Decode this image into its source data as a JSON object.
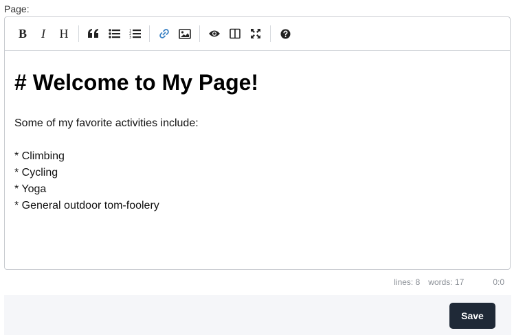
{
  "field_label": "Page:",
  "toolbar": {
    "groups": [
      [
        {
          "name": "bold-icon",
          "glyph": "B"
        },
        {
          "name": "italic-icon",
          "glyph": "I"
        },
        {
          "name": "heading-icon",
          "glyph": "H"
        }
      ],
      [
        {
          "name": "quote-icon"
        },
        {
          "name": "unordered-list-icon"
        },
        {
          "name": "ordered-list-icon"
        }
      ],
      [
        {
          "name": "link-icon",
          "color": "#3b82c4"
        },
        {
          "name": "image-icon"
        }
      ],
      [
        {
          "name": "preview-eye-icon"
        },
        {
          "name": "side-by-side-icon"
        },
        {
          "name": "fullscreen-icon"
        }
      ],
      [
        {
          "name": "help-icon"
        }
      ]
    ]
  },
  "editor": {
    "heading": "# Welcome to My Page!",
    "intro": "Some of my favorite activities include:",
    "items": [
      "* Climbing",
      "* Cycling",
      "* Yoga",
      "* General outdoor tom-foolery"
    ]
  },
  "status": {
    "lines": "lines: 8",
    "words": "words: 17",
    "cursor": "0:0"
  },
  "footer": {
    "save_label": "Save"
  },
  "colors": {
    "save_button_bg": "#1f2937",
    "link_icon": "#3b82c4",
    "footer_bg": "#f5f6f9"
  }
}
